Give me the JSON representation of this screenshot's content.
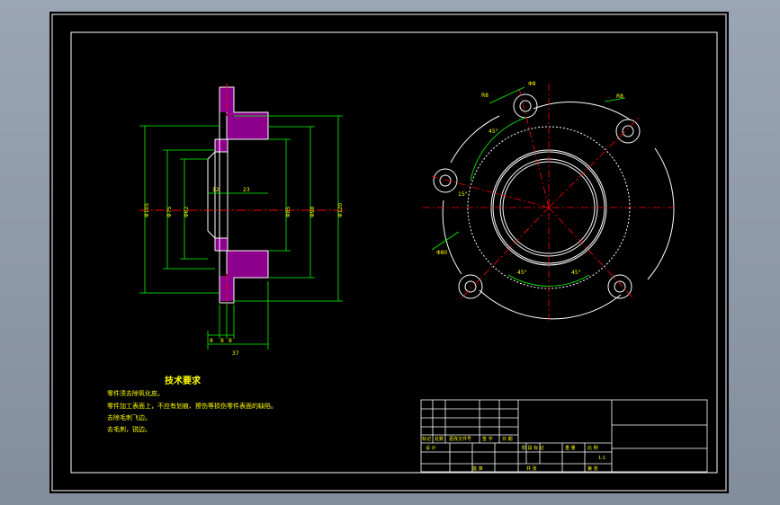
{
  "drawing": {
    "tech_title": "技术要求",
    "notes": [
      "零件须去除氧化皮。",
      "零件加工表面上，不应有划痕、擦伤等损伤零件表面的缺陷。",
      "去除毛刺飞边。",
      "去毛刺，锐边。"
    ],
    "section_dims": {
      "d1": "12",
      "d2": "23",
      "phi_a": "Φ105",
      "phi_b": "Φ75",
      "phi_c": "Φ62",
      "phi_d": "Φ85",
      "phi_e": "Φ98",
      "phi_f": "Φ120",
      "b1": "8",
      "b2": "8",
      "b3": "8",
      "b4": "37"
    },
    "plan_dims": {
      "angle_1": "45°",
      "angle_2": "45°",
      "angle_3": "45°",
      "angle_4": "15°",
      "phi_hole": "Φ8",
      "r1": "R8",
      "r2": "R8",
      "phi_pcd": "Φ80"
    },
    "title_block": {
      "scale": "1:1",
      "row_labels": [
        "标记",
        "处数",
        "更改文件号",
        "签 字",
        "日 期"
      ],
      "design": "设 计",
      "stage": "阶 段 标 记",
      "weight": "重 量",
      "ratio": "比 例",
      "approve": "批 准",
      "total": "共  张",
      "sheet": "第  张"
    }
  },
  "colors": {
    "outline": "#ffffff",
    "dimension": "#00ff00",
    "centerline": "#ff0000",
    "section": "#ff00ff",
    "text": "#ffff00"
  }
}
